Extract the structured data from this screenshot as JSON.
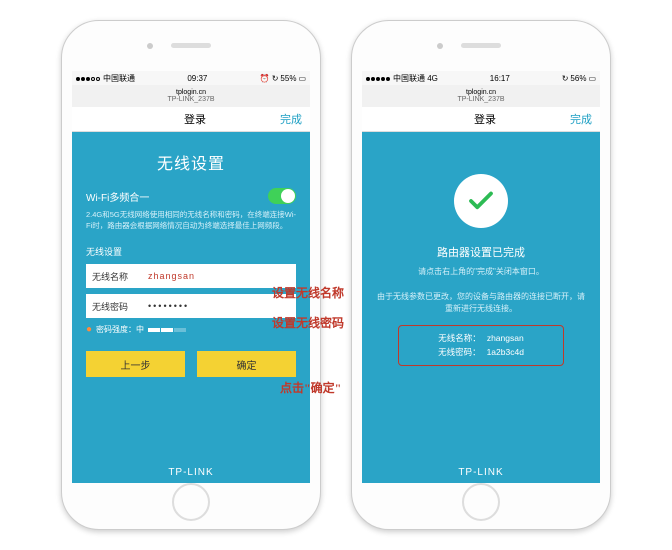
{
  "phone1": {
    "status": {
      "carrier": "中国联通",
      "signal_dots": 5,
      "signal_filled": 3,
      "time": "09:37",
      "alarm": "⏰",
      "orient": "↻",
      "battery": "55%"
    },
    "url": {
      "host": "tplogin.cn",
      "ssid": "TP-LINK_237B"
    },
    "nav": {
      "title": "登录",
      "done": "完成"
    },
    "page_title": "无线设置",
    "toggle_label": "Wi-Fi多频合一",
    "desc": "2.4G和5G无线网络使用相同的无线名称和密码，在终端连接Wi-Fi时，路由器会根据网络情况自动为终端选择最佳上网频段。",
    "section_label": "无线设置",
    "name_label": "无线名称",
    "name_value": "zhangsan",
    "pwd_label": "无线密码",
    "pwd_value": "••••••••",
    "strength_label": "密码强度：中",
    "btn_prev": "上一步",
    "btn_ok": "确定",
    "brand": "TP-LINK"
  },
  "phone2": {
    "status": {
      "carrier": "中国联通 4G",
      "time": "16:17",
      "orient": "↻",
      "battery": "56%"
    },
    "url": {
      "host": "tplogin.cn",
      "ssid": "TP-LINK_237B"
    },
    "nav": {
      "title": "登录",
      "done": "完成"
    },
    "done_title": "路由器设置已完成",
    "done_sub": "请点击右上角的\"完成\"关闭本窗口。",
    "done_note": "由于无线参数已更改，您的设备与路由器的连接已断开，请重新进行无线连接。",
    "info_name_label": "无线名称：",
    "info_name_value": "zhangsan",
    "info_pwd_label": "无线密码：",
    "info_pwd_value": "1a2b3c4d",
    "brand": "TP-LINK"
  },
  "annotations": {
    "a1": "设置无线名称",
    "a2": "设置无线密码",
    "a3": "点击\"确定\""
  }
}
